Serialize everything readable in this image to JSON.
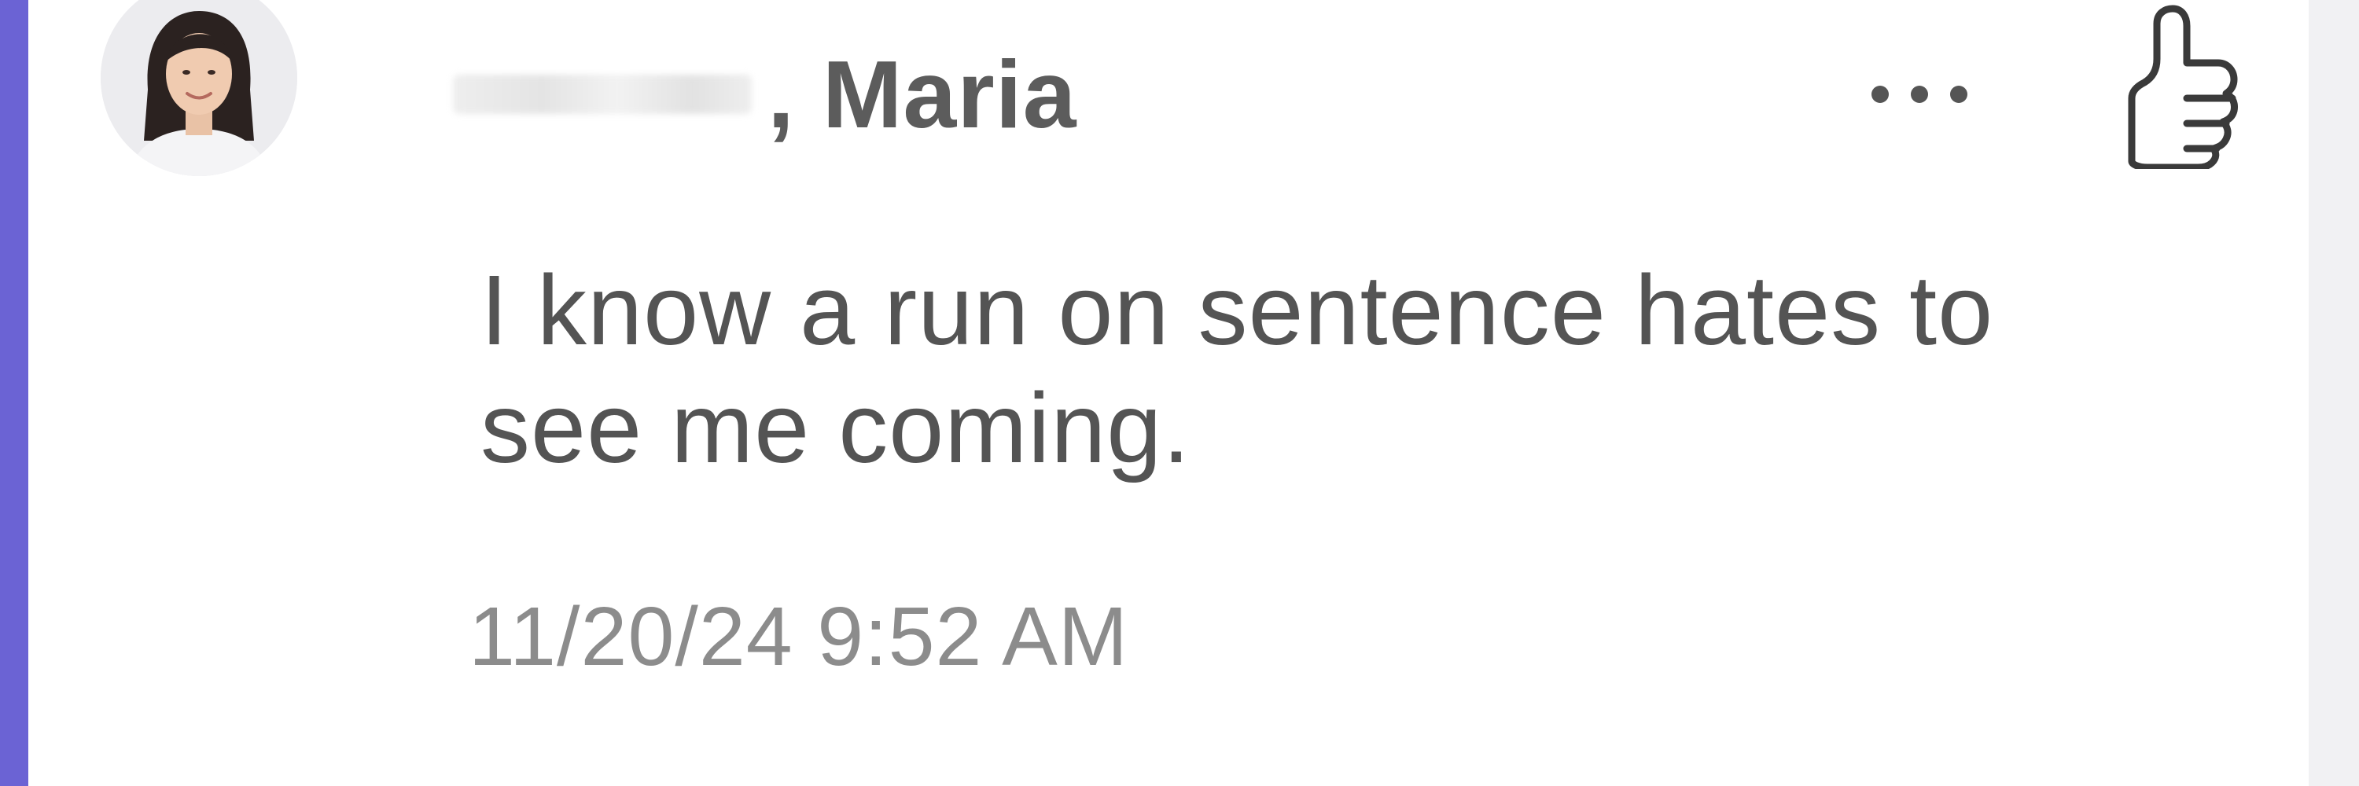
{
  "message": {
    "author": {
      "first_name_redacted": "",
      "last_name": ", Maria"
    },
    "body": "I know a run on sentence hates to see me coming.",
    "timestamp": "11/20/24 9:52 AM",
    "avatar_icon": "avatar-icon",
    "more_icon": "more-options-icon",
    "like_icon": "thumbs-up-icon"
  },
  "colors": {
    "accent": "#6b63d4",
    "author_text": "#5c5c5c",
    "body_text": "#545454",
    "timestamp_text": "#8c8c8c"
  }
}
